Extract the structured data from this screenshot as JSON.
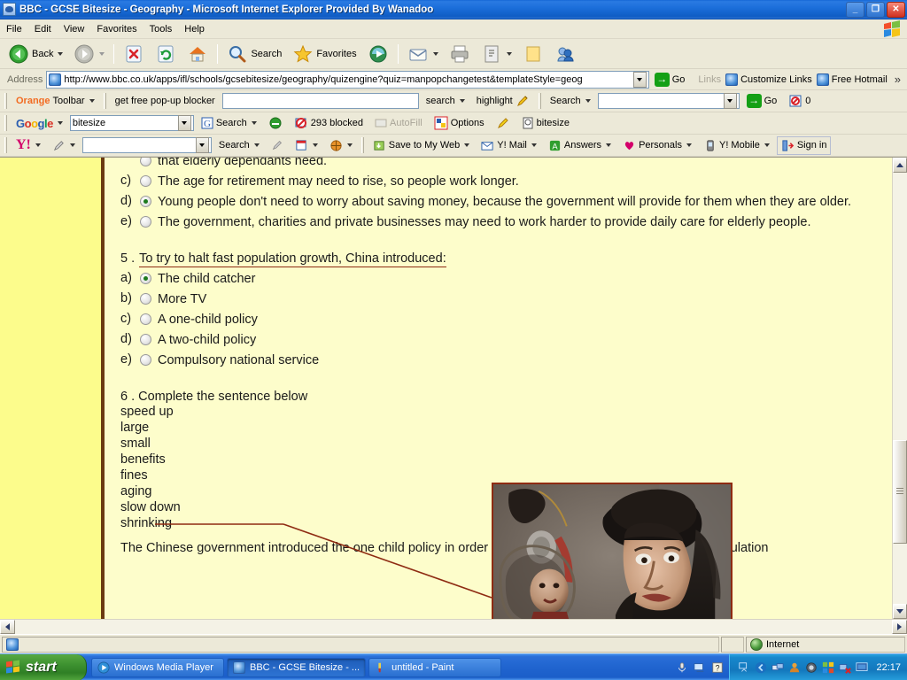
{
  "window": {
    "title": "BBC - GCSE Bitesize - Geography - Microsoft Internet Explorer Provided By Wanadoo",
    "minimize_label": "_",
    "maximize_label": "❐",
    "close_label": "✕"
  },
  "menu": {
    "items": [
      {
        "label": "File"
      },
      {
        "label": "Edit"
      },
      {
        "label": "View"
      },
      {
        "label": "Favorites"
      },
      {
        "label": "Tools"
      },
      {
        "label": "Help"
      }
    ]
  },
  "toolbar": {
    "back_label": "Back",
    "search_label": "Search",
    "favorites_label": "Favorites",
    "icons": {
      "back": "back-arrow-icon",
      "forward": "forward-arrow-icon",
      "stop": "stop-icon",
      "refresh": "refresh-icon",
      "home": "home-icon",
      "search": "magnifier-icon",
      "favorites": "star-icon",
      "media": "media-icon",
      "mail": "mail-icon",
      "print": "printer-icon",
      "edit": "edit-page-icon",
      "notes": "notes-icon",
      "messenger": "messenger-icon"
    }
  },
  "address": {
    "label": "Address",
    "url": "http://www.bbc.co.uk/apps/ifl/schools/gcsebitesize/geography/quizengine?quiz=manpopchangetest&templateStyle=geog",
    "go_label": "Go",
    "links_label": "Links",
    "link_items": [
      {
        "label": "Customize Links"
      },
      {
        "label": "Free Hotmail"
      }
    ],
    "overflow_label": "»"
  },
  "orange_toolbar": {
    "brand_orange": "Orange",
    "brand_rest": "Toolbar",
    "popup_blocker_label": "get free pop-up blocker",
    "search_value": "",
    "search_label": "search",
    "highlight_label": "highlight",
    "second_search_label": "Search",
    "second_search_value": "",
    "go_label": "Go",
    "blocked_count": "0"
  },
  "google_toolbar": {
    "logo": "Google",
    "search_value": "bitesize",
    "search_label": "Search",
    "blocked_label": "293 blocked",
    "autofill_label": "AutoFill",
    "options_label": "Options",
    "highlight_button_label": "bitesize"
  },
  "yahoo_toolbar": {
    "logo": "Y!",
    "search_value": "",
    "search_label": "Search",
    "items": [
      {
        "label": "Save to My Web"
      },
      {
        "label": "Y! Mail"
      },
      {
        "label": "Answers"
      },
      {
        "label": "Personals"
      },
      {
        "label": "Y! Mobile"
      },
      {
        "label": "Sign in"
      }
    ]
  },
  "page": {
    "question4": {
      "options": [
        {
          "letter": "b)",
          "text": "that elderly dependants need.",
          "selected": false,
          "clipped": true
        },
        {
          "letter": "c)",
          "text": "The age for retirement may need to rise, so people work longer.",
          "selected": false
        },
        {
          "letter": "d)",
          "text": "Young people don't need to worry about saving money, because the government will provide for them when they are older.",
          "selected": true
        },
        {
          "letter": "e)",
          "text": "The government, charities and private businesses may need to work harder to provide daily care for elderly people.",
          "selected": false
        }
      ]
    },
    "question5": {
      "number": "5 .",
      "prompt": "To try to halt fast population growth, China introduced:",
      "options": [
        {
          "letter": "a)",
          "text": "The child catcher",
          "selected": true
        },
        {
          "letter": "b)",
          "text": "More TV",
          "selected": false
        },
        {
          "letter": "c)",
          "text": "A one-child policy",
          "selected": false
        },
        {
          "letter": "d)",
          "text": "A two-child policy",
          "selected": false
        },
        {
          "letter": "e)",
          "text": "Compulsory national service",
          "selected": false
        }
      ]
    },
    "question6": {
      "heading": "6 . Complete the sentence below",
      "words": [
        "speed up",
        "large",
        "small",
        "benefits",
        "fines",
        "aging",
        "slow down",
        "shrinking"
      ],
      "sentence_before": "The Chinese government introduced the one child policy in order to",
      "blank_value": "",
      "sentence_after": "the rate of population"
    },
    "photo": {
      "caption": "child-catcher-photograph",
      "border_color": "#8e2b12"
    },
    "annotation_color": "#8e2b12"
  },
  "status": {
    "zone_label": "Internet"
  },
  "taskbar": {
    "start_label": "start",
    "tasks": [
      {
        "label": "Windows Media Player",
        "active": false
      },
      {
        "label": "BBC - GCSE Bitesize - ...",
        "active": true
      },
      {
        "label": "untitled - Paint",
        "active": false
      }
    ],
    "clock": "22:17"
  }
}
